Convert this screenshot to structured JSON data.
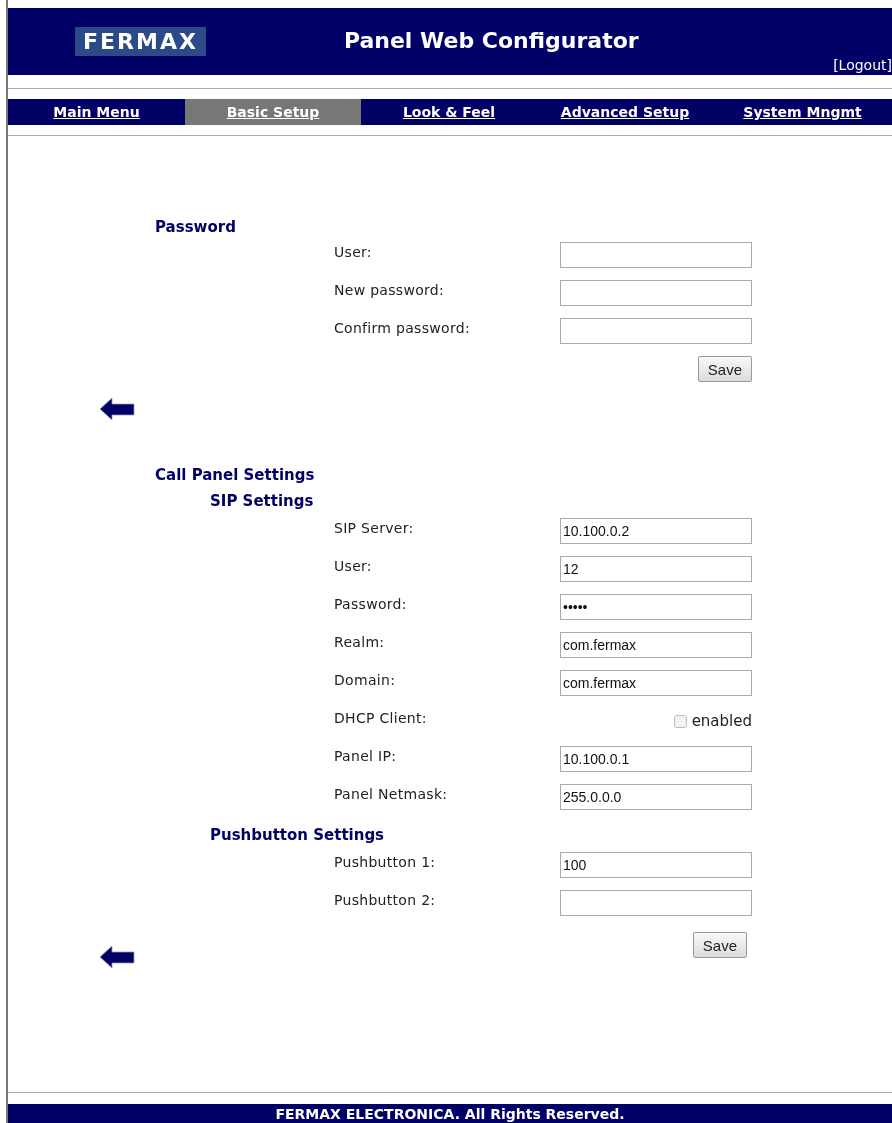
{
  "header": {
    "logo": "FERMAX",
    "title": "Panel Web Configurator",
    "logout": "[Logout]"
  },
  "nav": [
    {
      "label": "Main Menu",
      "selected": false
    },
    {
      "label": "Basic Setup",
      "selected": true
    },
    {
      "label": "Look & Feel",
      "selected": false
    },
    {
      "label": "Advanced Setup",
      "selected": false
    },
    {
      "label": "System Mngmt",
      "selected": false
    }
  ],
  "sections": [
    {
      "title": "Password",
      "groups": [
        {
          "rows": [
            {
              "kind": "text",
              "label": "User:"
            },
            {
              "kind": "text",
              "label": "New password:"
            },
            {
              "kind": "text",
              "label": "Confirm password:"
            }
          ]
        }
      ],
      "button": "Save"
    },
    {
      "title": "Call Panel Settings",
      "groups": [
        {
          "title": "SIP Settings",
          "rows": [
            {
              "kind": "text",
              "label": "SIP Server:",
              "value": "10.100.0.2"
            },
            {
              "kind": "text",
              "label": "User:",
              "value": "12"
            },
            {
              "kind": "text",
              "label": "Password:",
              "value": "•••••"
            },
            {
              "kind": "text",
              "label": "Realm:",
              "value": "com.fermax"
            },
            {
              "kind": "text",
              "label": "Domain:",
              "value": "com.fermax"
            },
            {
              "kind": "checkbox",
              "label": "DHCP Client:",
              "option": "enabled",
              "checked": false
            },
            {
              "kind": "text",
              "label": "Panel IP:",
              "value": "10.100.0.1"
            },
            {
              "kind": "text",
              "label": "Panel Netmask:",
              "value": "255.0.0.0"
            }
          ]
        },
        {
          "title": "Pushbutton Settings",
          "rows": [
            {
              "kind": "text",
              "label": "Pushbutton 1:",
              "value": "100"
            },
            {
              "kind": "text",
              "label": "Pushbutton 2:"
            }
          ]
        }
      ],
      "button": "Save"
    }
  ],
  "footer": "FERMAX ELECTRONICA. All Rights Reserved."
}
